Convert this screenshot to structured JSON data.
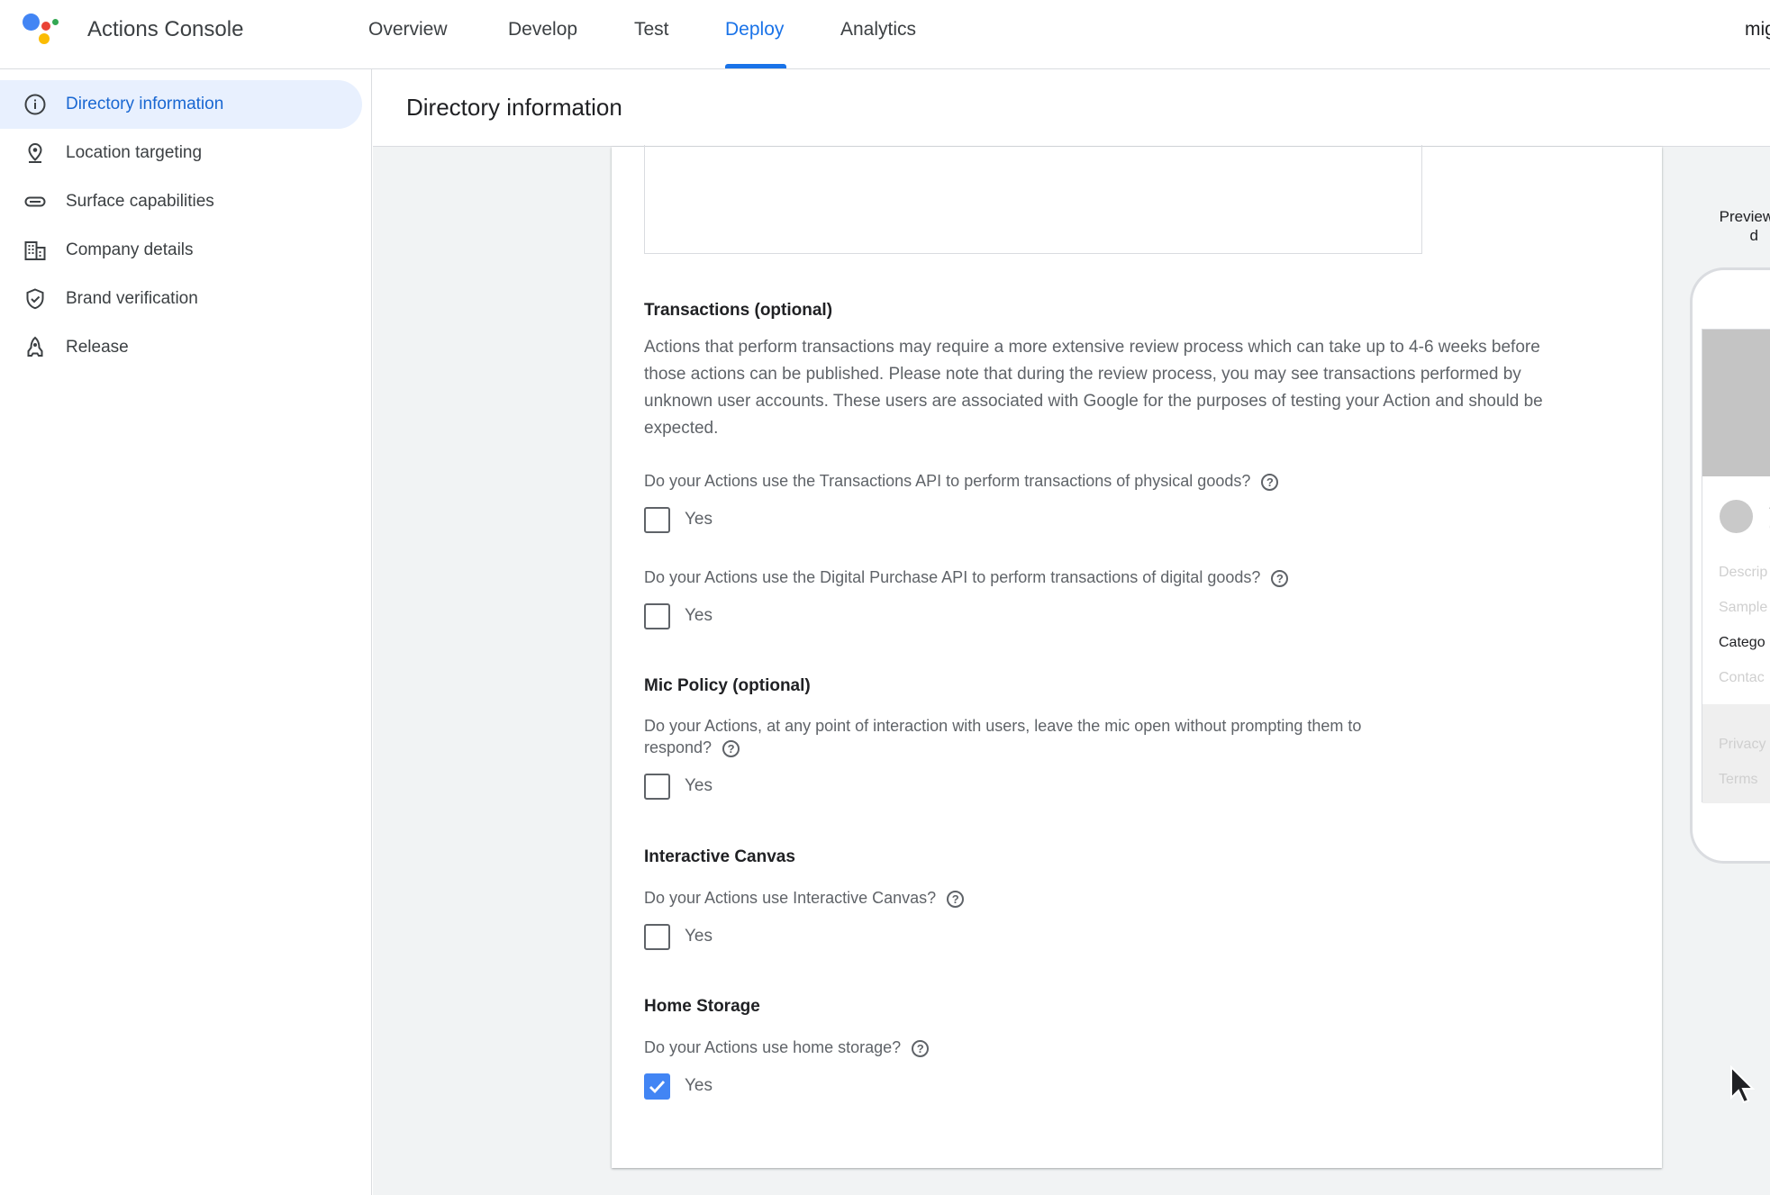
{
  "app": {
    "title": "Actions Console",
    "user": "mig"
  },
  "nav": {
    "tabs": [
      {
        "label": "Overview"
      },
      {
        "label": "Develop"
      },
      {
        "label": "Test"
      },
      {
        "label": "Deploy",
        "active": true
      },
      {
        "label": "Analytics"
      }
    ]
  },
  "sidebar": {
    "items": [
      {
        "label": "Directory information",
        "icon": "info-icon",
        "active": true
      },
      {
        "label": "Location targeting",
        "icon": "location-pin-icon"
      },
      {
        "label": "Surface capabilities",
        "icon": "link-icon"
      },
      {
        "label": "Company details",
        "icon": "building-icon"
      },
      {
        "label": "Brand verification",
        "icon": "shield-check-icon"
      },
      {
        "label": "Release",
        "icon": "rocket-icon"
      }
    ]
  },
  "page": {
    "title": "Directory information"
  },
  "sections": {
    "transactions": {
      "title": "Transactions (optional)",
      "description": "Actions that perform transactions may require a more extensive review process which can take up to 4-6 weeks before those actions can be published. Please note that during the review process, you may see transactions performed by unknown user accounts. These users are associated with Google for the purposes of testing your Action and should be expected.",
      "q1": "Do your Actions use the Transactions API to perform transactions of physical goods?",
      "q1_yes": "Yes",
      "q1_checked": false,
      "q2": "Do your Actions use the Digital Purchase API to perform transactions of digital goods?",
      "q2_yes": "Yes",
      "q2_checked": false
    },
    "mic_policy": {
      "title": "Mic Policy (optional)",
      "question": "Do your Actions, at any point of interaction with users, leave the mic open without prompting them to respond?",
      "yes": "Yes",
      "checked": false
    },
    "interactive_canvas": {
      "title": "Interactive Canvas",
      "question": "Do your Actions use Interactive Canvas?",
      "yes": "Yes",
      "checked": false
    },
    "home_storage": {
      "title": "Home Storage",
      "question": "Do your Actions use home storage?",
      "yes": "Yes",
      "checked": true
    }
  },
  "preview": {
    "label_line1": "Preview o",
    "label_line2": "d",
    "app_line1": "A",
    "app_line2": "C",
    "rows": [
      "Descrip",
      "Sample",
      "Catego",
      "Contac"
    ],
    "footer": [
      "Privacy",
      "Terms"
    ]
  },
  "colors": {
    "accent": "#1a73e8",
    "active_bg": "#e8f0fe",
    "checkbox_checked": "#4285f4"
  }
}
